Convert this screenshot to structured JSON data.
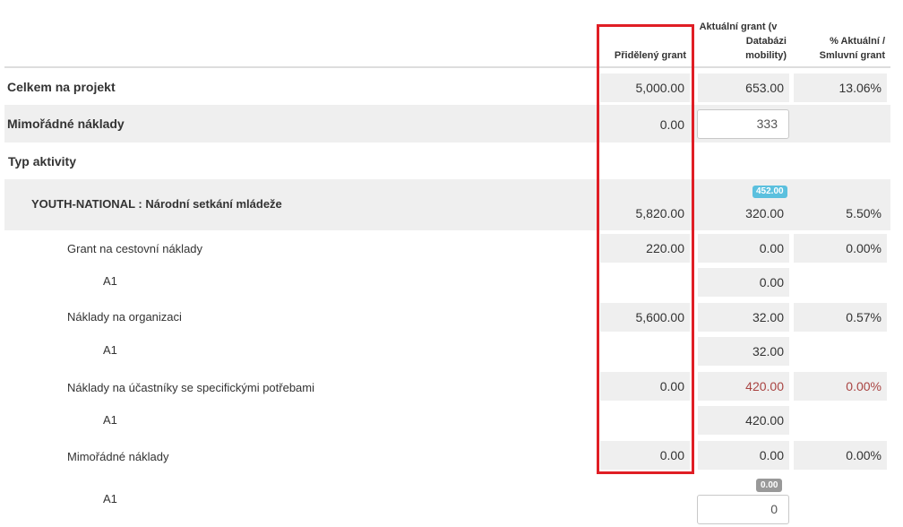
{
  "headers": {
    "allocated": "Přidělený grant",
    "actual_line1": "Aktuální grant (v",
    "actual_line2": "Databázi",
    "actual_line3": "mobility)",
    "percent_line1": "% Aktuální /",
    "percent_line2": "Smluvní grant"
  },
  "rows": {
    "total": {
      "label": "Celkem na projekt",
      "allocated": "5,000.00",
      "actual": "653.00",
      "percent": "13.06%"
    },
    "exceptional": {
      "label": "Mimořádné náklady",
      "allocated": "0.00",
      "actual_input": "333"
    },
    "activity_type": {
      "label": "Typ aktivity"
    },
    "youth": {
      "label": "YOUTH-NATIONAL : Národní setkání mládeže",
      "badge": "452.00",
      "allocated": "5,820.00",
      "actual": "320.00",
      "percent": "5.50%"
    },
    "travel": {
      "label": "Grant na cestovní náklady",
      "allocated": "220.00",
      "actual": "0.00",
      "percent": "0.00%"
    },
    "travel_a1": {
      "label": "A1",
      "actual": "0.00"
    },
    "org": {
      "label": "Náklady na organizaci",
      "allocated": "5,600.00",
      "actual": "32.00",
      "percent": "0.57%"
    },
    "org_a1": {
      "label": "A1",
      "actual": "32.00"
    },
    "special": {
      "label": "Náklady na účastníky se specifickými potřebami",
      "allocated": "0.00",
      "actual": "420.00",
      "percent": "0.00%"
    },
    "special_a1": {
      "label": "A1",
      "actual": "420.00"
    },
    "exc2": {
      "label": "Mimořádné náklady",
      "allocated": "0.00",
      "actual": "0.00",
      "percent": "0.00%"
    },
    "exc2_a1": {
      "label": "A1",
      "badge": "0.00",
      "actual_input": "0"
    }
  },
  "colors": {
    "highlight": "#e01e25",
    "badge_blue": "#5bc0de",
    "badge_gray": "#999999",
    "negative_red": "#a94442"
  }
}
